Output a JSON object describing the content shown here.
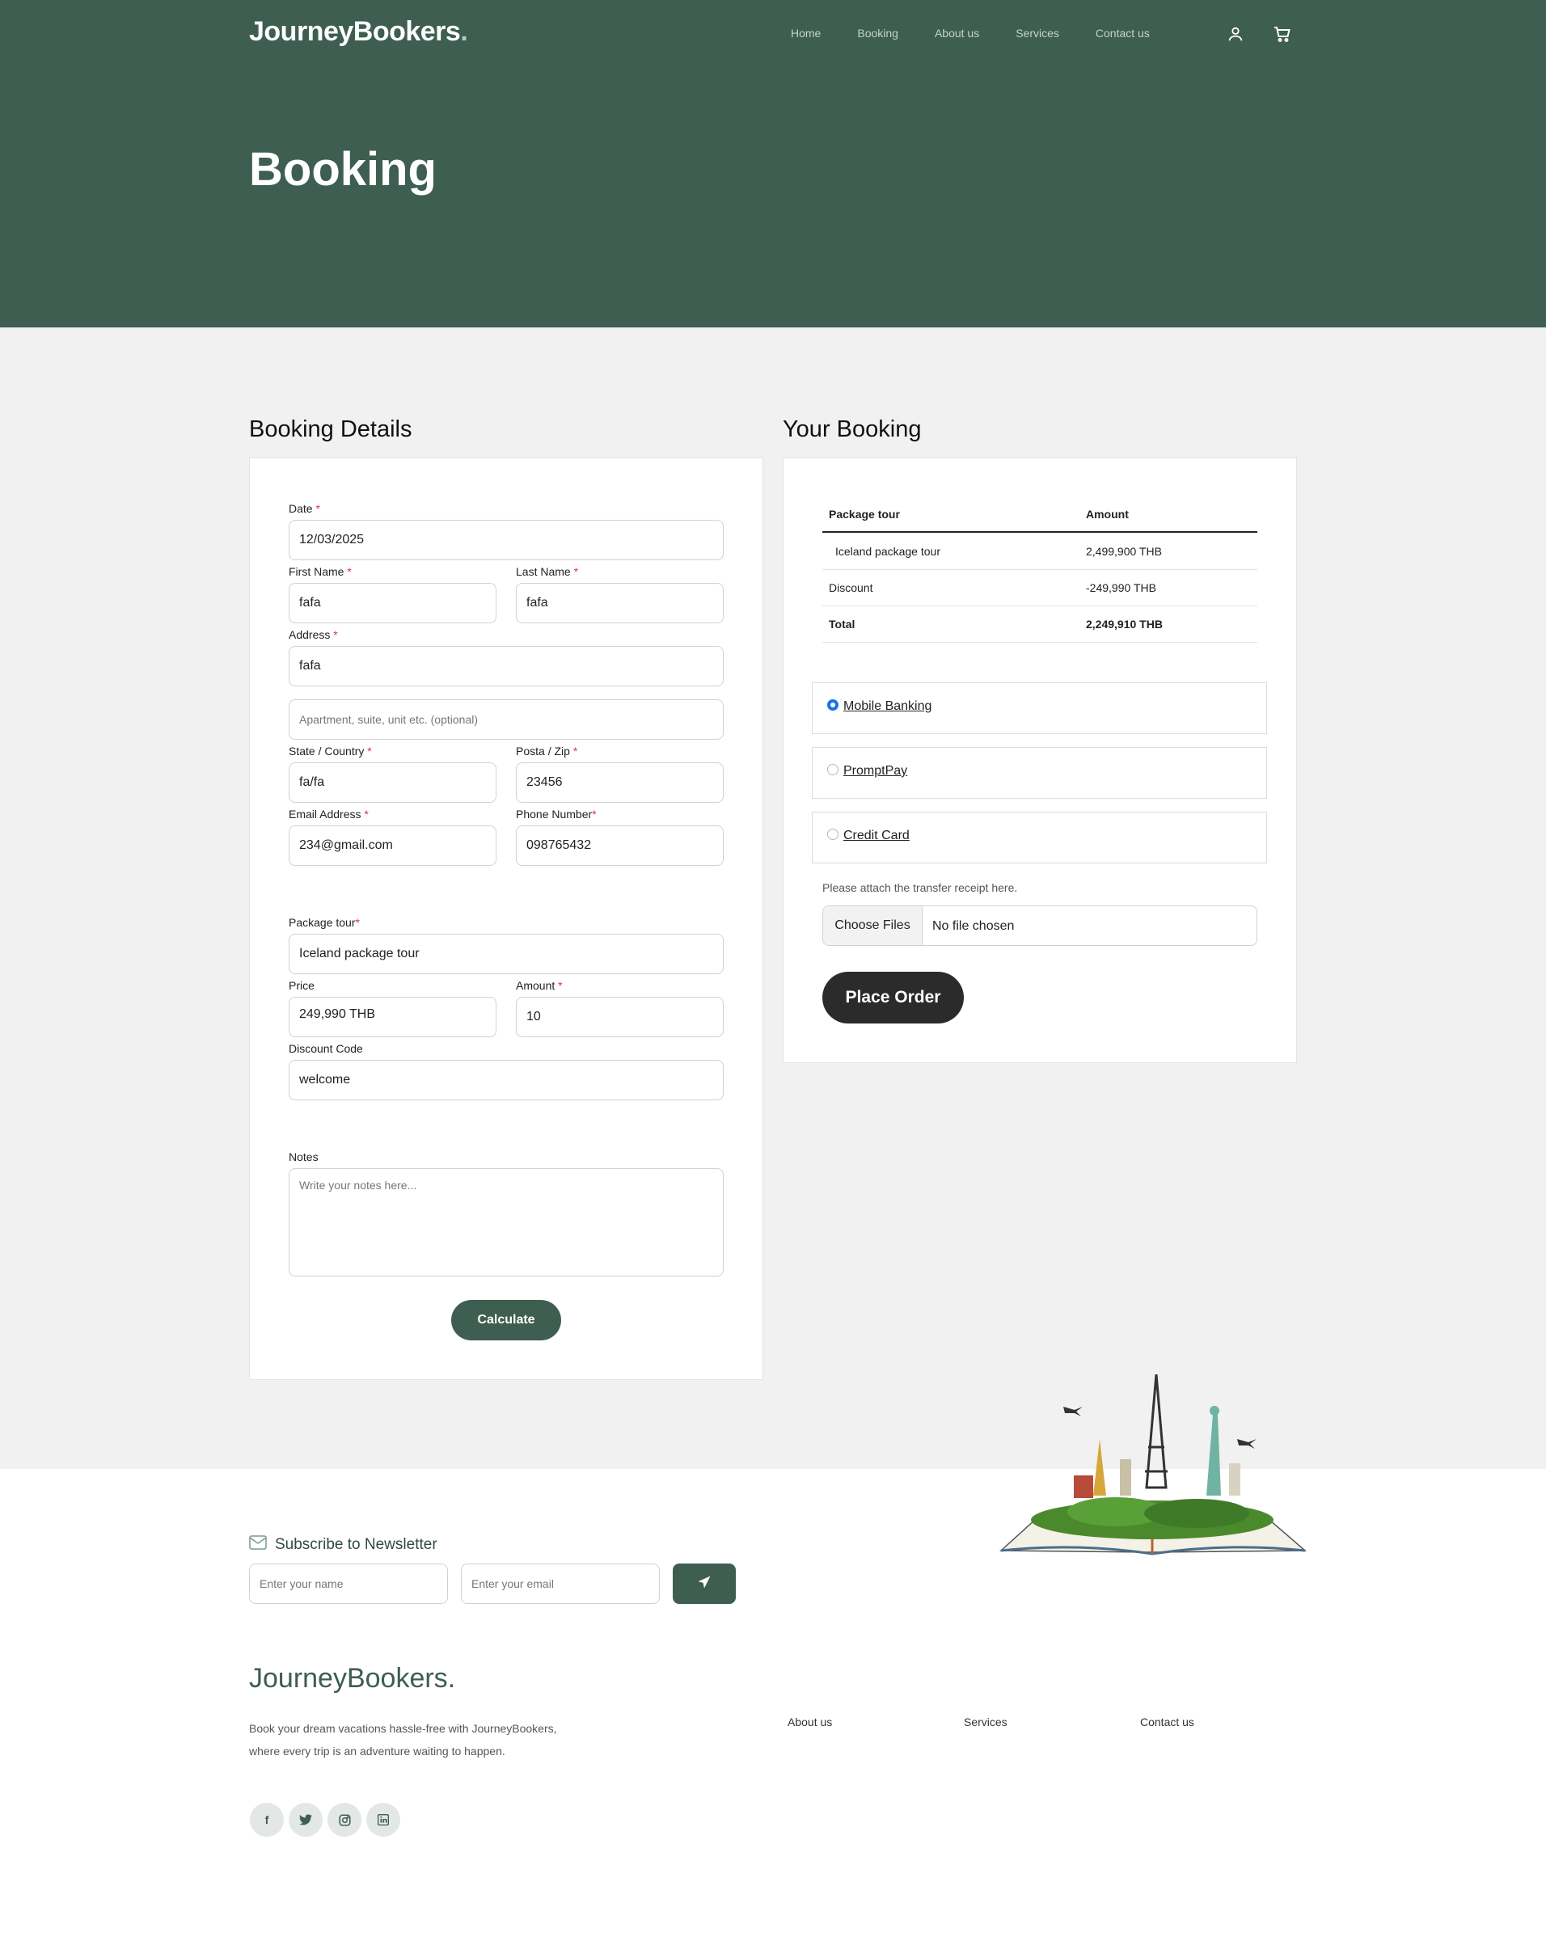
{
  "header": {
    "logo": "JourneyBookers",
    "logo_dot": ".",
    "nav": [
      "Home",
      "Booking",
      "About us",
      "Services",
      "Contact us"
    ],
    "icons": [
      "user-icon",
      "cart-icon"
    ]
  },
  "hero": {
    "title": "Booking"
  },
  "booking_details": {
    "title": "Booking Details",
    "date_label": "Date",
    "date_value": "12/03/2025",
    "first_name_label": "First Name",
    "first_name_value": "fafa",
    "last_name_label": "Last Name",
    "last_name_value": "fafa",
    "address_label": "Address",
    "address_value": "fafa",
    "address2_placeholder": "Apartment, suite, unit etc. (optional)",
    "state_label": "State / Country",
    "state_value": "fa/fa",
    "zip_label": "Posta / Zip",
    "zip_value": "23456",
    "email_label": "Email Address",
    "email_value": "234@gmail.com",
    "phone_label": "Phone Number",
    "phone_value": "098765432",
    "package_label": "Package tour",
    "package_value": "Iceland package tour",
    "price_label": "Price",
    "price_value": "249,990 THB",
    "amount_label": "Amount",
    "amount_value": "10",
    "discount_label": "Discount Code",
    "discount_value": "welcome",
    "notes_label": "Notes",
    "notes_placeholder": "Write your notes here...",
    "calculate_button": "Calculate",
    "required_mark": "*"
  },
  "your_booking": {
    "title": "Your Booking",
    "table": {
      "headers": [
        "Package tour",
        "Amount"
      ],
      "rows": [
        [
          "Iceland package tour",
          "2,499,900 THB"
        ],
        [
          "Discount",
          "-249,990 THB"
        ],
        [
          "Total",
          "2,249,910 THB"
        ]
      ]
    },
    "payment_options": [
      {
        "label": "Mobile Banking",
        "selected": true
      },
      {
        "label": "PromptPay",
        "selected": false
      },
      {
        "label": "Credit Card",
        "selected": false
      }
    ],
    "attach_hint": "Please attach the transfer receipt here.",
    "choose_files": "Choose Files",
    "no_file": "No file chosen",
    "place_order": "Place Order"
  },
  "newsletter": {
    "title": "Subscribe to Newsletter",
    "name_placeholder": "Enter your name",
    "email_placeholder": "Enter your email"
  },
  "footer": {
    "logo": "JourneyBookers.",
    "description": "Book your dream vacations hassle-free with JourneyBookers, where every trip is an adventure waiting to happen.",
    "links": [
      "About us",
      "Services",
      "Contact us"
    ],
    "social": [
      "f",
      "t",
      "ig",
      "in"
    ]
  },
  "colors": {
    "brand_green": "#3d5e50",
    "radio_selected": "#1a73e8",
    "required_red": "#d9363e"
  }
}
